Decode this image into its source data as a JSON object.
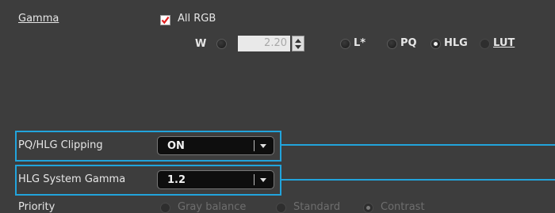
{
  "gamma": {
    "title": "Gamma",
    "all_rgb_label": "All RGB",
    "all_rgb_checked": true,
    "w_label": "W",
    "w_value": "2.20",
    "options": [
      {
        "label": "L*",
        "selected": false
      },
      {
        "label": "PQ",
        "selected": false
      },
      {
        "label": "HLG",
        "selected": true
      },
      {
        "label": "LUT",
        "selected": false
      }
    ]
  },
  "pq_hlg_clipping": {
    "label": "PQ/HLG Clipping",
    "value": "ON"
  },
  "hlg_system_gamma": {
    "label": "HLG System Gamma",
    "value": "1.2"
  },
  "priority": {
    "label": "Priority",
    "options": [
      {
        "label": "Gray balance",
        "selected": false
      },
      {
        "label": "Standard",
        "selected": false
      },
      {
        "label": "Contrast",
        "selected": true
      }
    ]
  },
  "colors": {
    "background": "#3d3d3d",
    "highlight": "#22a4dc",
    "checkbox_mark": "#e02020"
  }
}
